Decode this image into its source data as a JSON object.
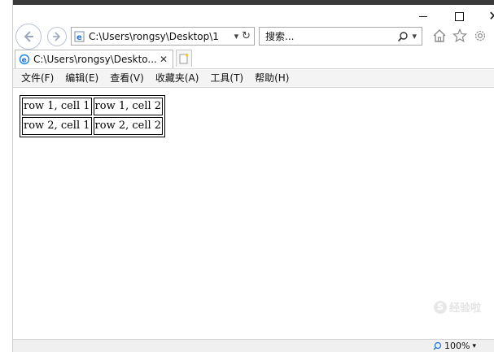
{
  "window": {
    "caption": {
      "minimize": "—",
      "maximize": "☐",
      "close": "✕"
    }
  },
  "toolbar": {
    "address": {
      "value": "C:\\Users\\rongsy\\Desktop\\1",
      "icon": "ie-page-icon"
    },
    "search": {
      "placeholder": "搜索..."
    }
  },
  "tab": {
    "title": "C:\\Users\\rongsy\\Deskto...",
    "close_label": "✕"
  },
  "menu": {
    "items": [
      {
        "label": "文件(F)"
      },
      {
        "label": "编辑(E)"
      },
      {
        "label": "查看(V)"
      },
      {
        "label": "收藏夹(A)"
      },
      {
        "label": "工具(T)"
      },
      {
        "label": "帮助(H)"
      }
    ]
  },
  "content": {
    "table": [
      [
        "row 1, cell 1",
        "row 1, cell 2"
      ],
      [
        "row 2, cell 1",
        "row 2, cell 2"
      ]
    ]
  },
  "status": {
    "zoom": "100%"
  },
  "watermark": {
    "text": "经验啦"
  }
}
